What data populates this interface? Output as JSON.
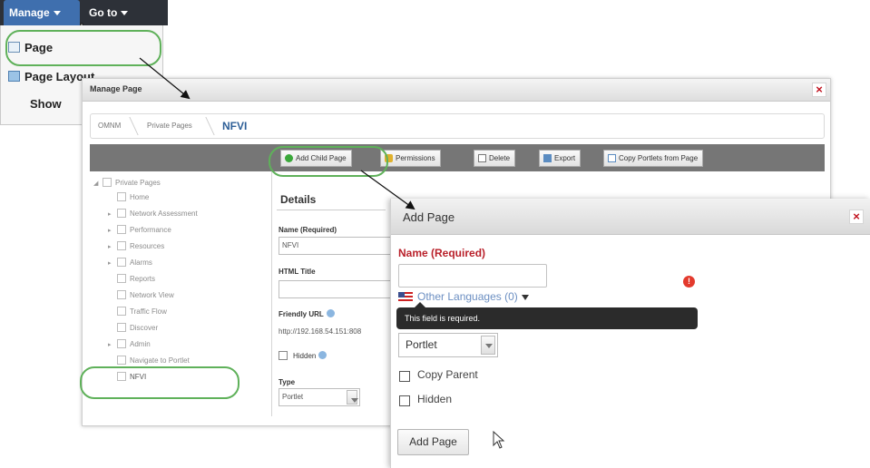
{
  "menubar": {
    "manage_label": "Manage",
    "goto_label": "Go to",
    "dropdown": [
      {
        "label": "Page",
        "icon": "page-icon"
      },
      {
        "label": "Page Layout",
        "icon": "layout-icon"
      },
      {
        "label": "Show"
      }
    ]
  },
  "manage_page": {
    "title": "Manage Page",
    "close_label": "×",
    "breadcrumb": [
      "OMNM",
      "Private Pages",
      "NFVI"
    ],
    "toolbar": [
      "Add Child Page",
      "Permissions",
      "Delete",
      "Export",
      "Copy Portlets from Page"
    ],
    "tree": [
      {
        "label": "Private Pages",
        "expander": "◢"
      },
      {
        "label": "Home",
        "expander": ""
      },
      {
        "label": "Network Assessment",
        "expander": "▸"
      },
      {
        "label": "Performance",
        "expander": "▸"
      },
      {
        "label": "Resources",
        "expander": "▸"
      },
      {
        "label": "Alarms",
        "expander": "▸"
      },
      {
        "label": "Reports",
        "expander": ""
      },
      {
        "label": "Network View",
        "expander": ""
      },
      {
        "label": "Traffic Flow",
        "expander": ""
      },
      {
        "label": "Discover",
        "expander": ""
      },
      {
        "label": "Admin",
        "expander": "▸"
      },
      {
        "label": "Navigate to Portlet",
        "expander": ""
      },
      {
        "label": "NFVI",
        "expander": ""
      }
    ],
    "details": {
      "heading": "Details",
      "name_label": "Name (Required)",
      "name_value": "NFVI",
      "html_title_label": "HTML Title",
      "friendly_url_label": "Friendly URL",
      "friendly_url_value": "http://192.168.54.151:808",
      "hidden_label": "Hidden",
      "type_label": "Type",
      "type_value": "Portlet"
    }
  },
  "add_page": {
    "title": "Add Page",
    "close_label": "×",
    "name_label": "Name (Required)",
    "name_value": "",
    "other_languages": "Other Languages (0)",
    "error_icon": "!",
    "tooltip": "This field is required.",
    "type_value": "Portlet",
    "copy_parent_label": "Copy Parent",
    "hidden_label": "Hidden",
    "add_button": "Add Page"
  },
  "colors": {
    "menubar": "#2d3138",
    "manage_active": "#3f6fae",
    "toolbar": "#767676",
    "required_red": "#b9202a",
    "close_red": "#c1121f",
    "annotation_green": "#5fb15a",
    "link_blue": "#6c8fc2"
  }
}
